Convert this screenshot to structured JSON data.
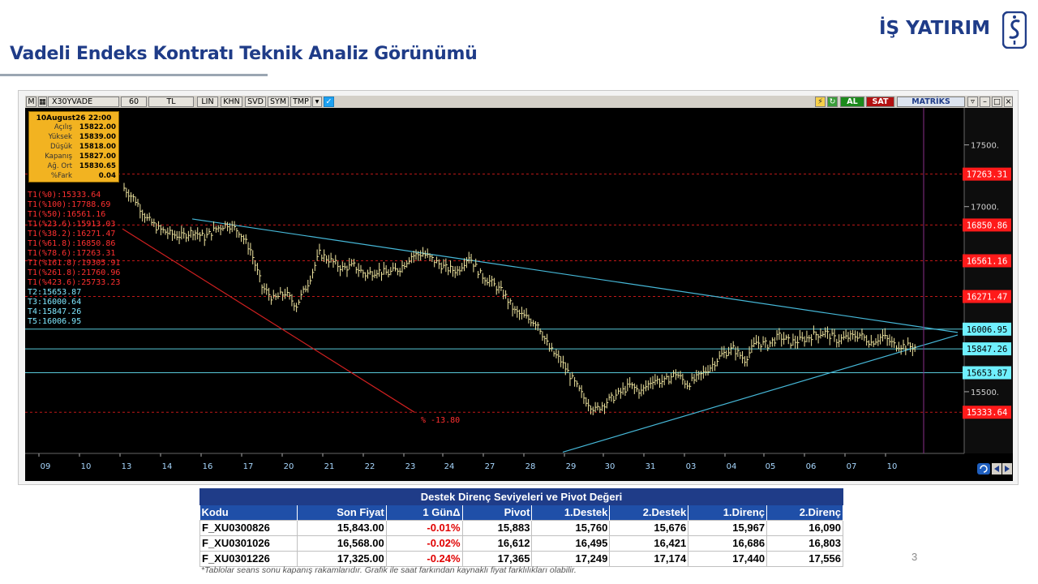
{
  "header": {
    "title": "Vadeli Endeks Kontratı Teknik Analiz Görünümü",
    "brand": "İŞ YATIRIM"
  },
  "toolbar": {
    "menu_glyph": "M",
    "symbol": "X30YVADE",
    "interval": "60",
    "currency": "TL",
    "buttons": [
      "LIN",
      "KHN",
      "SVD",
      "SYM",
      "TMP"
    ],
    "buy_label": "AL",
    "sell_label": "SAT",
    "logo": "MATRİKS"
  },
  "info_box": {
    "datetime": "10August26 22:00",
    "rows": [
      {
        "label": "Açılış",
        "value": "15822.00"
      },
      {
        "label": "Yüksek",
        "value": "15839.00"
      },
      {
        "label": "Düşük",
        "value": "15818.00"
      },
      {
        "label": "Kapanış",
        "value": "15827.00"
      },
      {
        "label": "Ağ. Ort",
        "value": "15830.65"
      },
      {
        "label": "%Fark",
        "value": "0.04"
      }
    ]
  },
  "levels": [
    {
      "label": "T1(%0):15333.64",
      "color": "#ff3030"
    },
    {
      "label": "T1(%100):17788.69",
      "color": "#ff3030"
    },
    {
      "label": "T1(%50):16561.16",
      "color": "#ff3030"
    },
    {
      "label": "T1(%23.6):15913.03",
      "color": "#ff3030"
    },
    {
      "label": "T1(%38.2):16271.47",
      "color": "#ff3030"
    },
    {
      "label": "T1(%61.8):16850.86",
      "color": "#ff3030"
    },
    {
      "label": "T1(%78.6):17263.31",
      "color": "#ff3030"
    },
    {
      "label": "T1(%161.8):19305.91",
      "color": "#ff3030"
    },
    {
      "label": "T1(%261.8):21760.96",
      "color": "#ff3030"
    },
    {
      "label": "T1(%423.6):25733.23",
      "color": "#ff3030"
    },
    {
      "label": "T2:15653.87",
      "color": "#7fe8ff"
    },
    {
      "label": "T3:16000.64",
      "color": "#7fe8ff"
    },
    {
      "label": "T4:15847.26",
      "color": "#7fe8ff"
    },
    {
      "label": "T5:16006.95",
      "color": "#7fe8ff"
    }
  ],
  "chart_data": {
    "type": "line",
    "style": "ohlc-bars",
    "symbol": "X30YVADE",
    "x_ticks": [
      "09",
      "10",
      "13",
      "14",
      "16",
      "17",
      "20",
      "21",
      "22",
      "23",
      "24",
      "27",
      "28",
      "29",
      "30",
      "31",
      "03",
      "04",
      "05",
      "06",
      "07",
      "10"
    ],
    "y_ticks": [
      "17500.",
      "17000.",
      "15500."
    ],
    "ylim": [
      15000,
      17800
    ],
    "price_tags": [
      {
        "value": 17263.31,
        "label": "17263.31",
        "color": "#ff1a1a"
      },
      {
        "value": 16850.86,
        "label": "16850.86",
        "color": "#ff1a1a"
      },
      {
        "value": 16561.16,
        "label": "16561.16",
        "color": "#ff1a1a"
      },
      {
        "value": 16271.47,
        "label": "16271.47",
        "color": "#ff1a1a"
      },
      {
        "value": 16006.95,
        "label": "16006.95",
        "color": "#6ff0ff"
      },
      {
        "value": 15847.26,
        "label": "15847.26",
        "color": "#6ff0ff"
      },
      {
        "value": 15653.87,
        "label": "15653.87",
        "color": "#6ff0ff"
      },
      {
        "value": 15333.64,
        "label": "15333.64",
        "color": "#ff1a1a"
      }
    ],
    "annotation": "% -13.80",
    "series": [
      {
        "values": [
          17150,
          17050,
          16900,
          16820,
          16780,
          16760,
          16800,
          16750,
          16820,
          16860,
          16800,
          16650,
          16350,
          16250,
          16300,
          16200,
          16380,
          16620,
          16560,
          16500,
          16520,
          16450,
          16480,
          16460,
          16500,
          16600,
          16620,
          16560,
          16500,
          16480,
          16600,
          16450,
          16380,
          16300,
          16150,
          16100,
          16050,
          15850,
          15750,
          15600,
          15450,
          15350,
          15420,
          15480,
          15550,
          15500,
          15600,
          15580,
          15650,
          15560,
          15620,
          15700,
          15800,
          15850,
          15760,
          15900,
          15880,
          15950,
          15900,
          15920,
          15960,
          15980,
          15920,
          15940,
          15960,
          15900,
          15950,
          15880,
          15870,
          15860
        ]
      }
    ]
  },
  "table": {
    "caption": "Destek Direnç Seviyeleri ve Pivot Değeri",
    "headers": [
      "Kodu",
      "Son Fiyat",
      "1 GünΔ",
      "Pivot",
      "1.Destek",
      "2.Destek",
      "1.Direnç",
      "2.Direnç"
    ],
    "rows": [
      [
        "F_XU0300826",
        "15,843.00",
        "-0.01%",
        "15,883",
        "15,760",
        "15,676",
        "15,967",
        "16,090"
      ],
      [
        "F_XU0301026",
        "16,568.00",
        "-0.02%",
        "16,612",
        "16,495",
        "16,421",
        "16,686",
        "16,803"
      ],
      [
        "F_XU0301226",
        "17,325.00",
        "-0.24%",
        "17,365",
        "17,249",
        "17,174",
        "17,440",
        "17,556"
      ]
    ]
  },
  "footnote": "*Tablolar seans sonu kapanış rakamlarıdır. Grafik ile saat farkından kaynaklı fiyat farklılıkları olabilir.",
  "page_number": "3"
}
